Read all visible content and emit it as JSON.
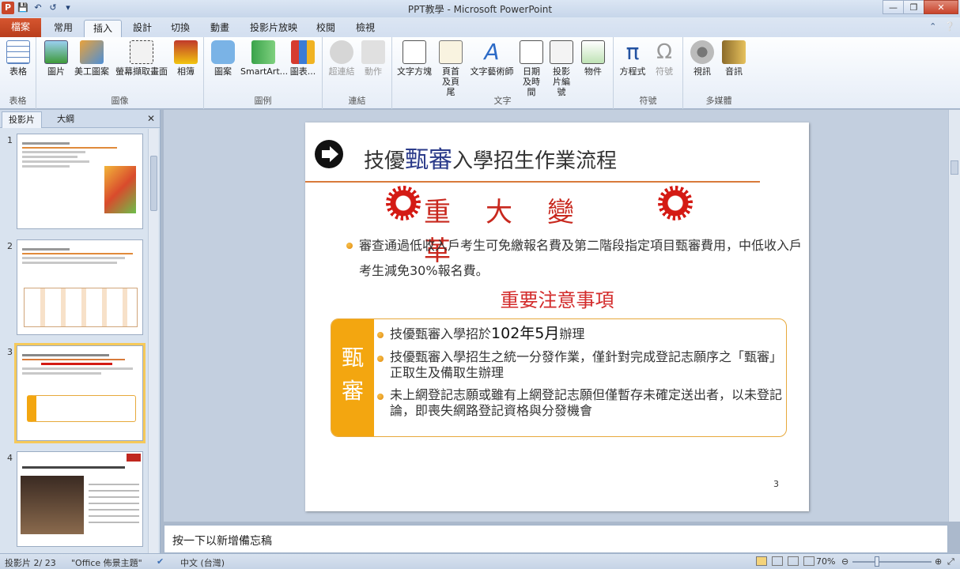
{
  "window": {
    "title": "PPT教學 - Microsoft PowerPoint"
  },
  "tabs": [
    "檔案",
    "常用",
    "插入",
    "設計",
    "切換",
    "動畫",
    "投影片放映",
    "校閱",
    "檢視"
  ],
  "ribbon": {
    "groups": {
      "tables": "表格",
      "images": "圖像",
      "illustrations": "圖例",
      "links": "連結",
      "text": "文字",
      "symbols": "符號",
      "media": "多媒體"
    },
    "buttons": {
      "table": "表格",
      "picture": "圖片",
      "clipart": "美工圖案",
      "screenshot": "螢幕擷取畫面",
      "album": "相簿",
      "shapes": "圖案",
      "smartart": "SmartArt...",
      "chart": "圖表...",
      "hyperlink": "超連結",
      "action": "動作",
      "textbox": "文字方塊",
      "header": "頁首及頁尾",
      "wordart": "文字藝術師",
      "datetime": "日期及時間",
      "slidenum": "投影片編號",
      "object": "物件",
      "equation": "方程式",
      "symbol": "符號",
      "video": "視訊",
      "audio": "音訊"
    }
  },
  "panel": {
    "tab_slides": "投影片",
    "tab_outline": "大綱",
    "slide_numbers": [
      "1",
      "2",
      "3",
      "4"
    ]
  },
  "slide": {
    "title_plain_1": "技優",
    "title_emph": "甄審",
    "title_plain_2": "入學招生作業流程",
    "reform_chars": "重大變革",
    "paragraph": "審查通過低收入戶考生可免繳報名費及第二階段指定項目甄審費用，中低收入戶考生減免30%報名費。",
    "notes_heading": "重要注意事項",
    "box_label": "甄審",
    "items": [
      {
        "pre": "技優甄審入學招於",
        "big": "102年5月",
        "post": "辦理"
      },
      {
        "text": "技優甄審入學招生之統一分發作業，僅針對完成登記志願序之「甄審」正取生及備取生辦理"
      },
      {
        "text": "未上網登記志願或雖有上網登記志願但僅暫存未確定送出者，以未登記論，即喪失網路登記資格與分發機會"
      }
    ],
    "page_number": "3"
  },
  "notes_placeholder": "按一下以新增備忘稿",
  "status": {
    "slide": "投影片 2/ 23",
    "theme": "\"Office 佈景主題\"",
    "language": "中文 (台灣)",
    "zoom": "70%"
  }
}
